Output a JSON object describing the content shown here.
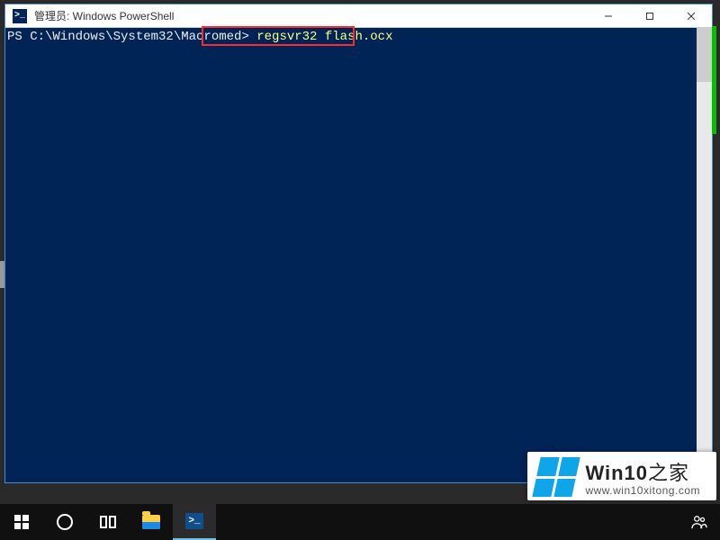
{
  "window": {
    "title": "管理员: Windows PowerShell",
    "controls": {
      "min": "minimize",
      "max": "maximize",
      "close": "close"
    }
  },
  "terminal": {
    "prompt": "PS C:\\Windows\\System32\\Macromed> ",
    "command": "regsvr32 flash.ocx"
  },
  "taskbar": {
    "items": [
      {
        "name": "start",
        "label": "Start"
      },
      {
        "name": "cortana",
        "label": "Cortana"
      },
      {
        "name": "taskview",
        "label": "Task View"
      },
      {
        "name": "explorer",
        "label": "File Explorer"
      },
      {
        "name": "powershell",
        "label": "Windows PowerShell",
        "active": true
      }
    ],
    "right": {
      "people": "People"
    }
  },
  "watermark": {
    "brand_en": "Win10",
    "brand_zh": "之家",
    "url": "www.win10xitong.com"
  }
}
